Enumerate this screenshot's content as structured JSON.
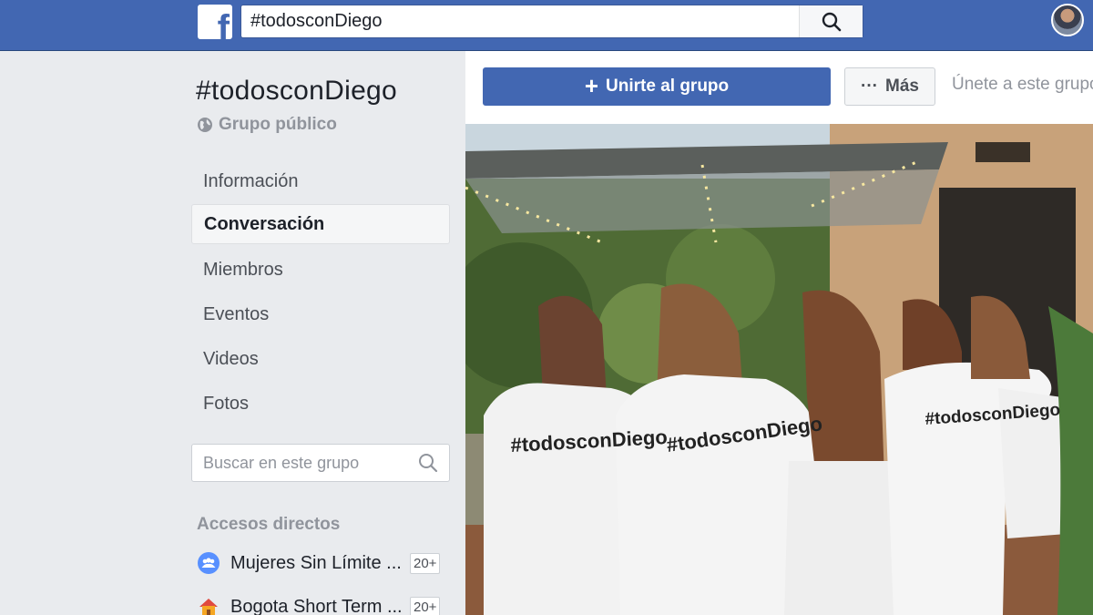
{
  "topbar": {
    "logo": "f",
    "search_value": "#todosconDiego",
    "search_icon": "search-icon"
  },
  "group": {
    "title": "#todosconDiego",
    "type": "Grupo público",
    "type_icon": "globe-icon"
  },
  "nav": {
    "items": [
      {
        "label": "Información"
      },
      {
        "label": "Conversación",
        "active": true
      },
      {
        "label": "Miembros"
      },
      {
        "label": "Eventos"
      },
      {
        "label": "Videos"
      },
      {
        "label": "Fotos"
      }
    ]
  },
  "group_search": {
    "placeholder": "Buscar en este grupo"
  },
  "shortcuts": {
    "title": "Accesos directos",
    "items": [
      {
        "label": "Mujeres Sin Límite ...",
        "badge": "20+",
        "icon": "group-icon"
      },
      {
        "label": "Bogota Short Term ...",
        "badge": "20+",
        "icon": "house-icon"
      }
    ]
  },
  "actions": {
    "join_plus": "+",
    "join_label": "Unirte al grupo",
    "more_dots": "···",
    "more_label": "Más",
    "join_hint": "Únete a este grupo"
  },
  "cover": {
    "shirt_text_1": "#todosconDiego",
    "shirt_text_2": "#todosconDiego",
    "shirt_text_3": "#todosconDiego",
    "colors": {
      "accent": "#4267b2",
      "wall": "#c8a27a",
      "foliage": "#4f6b35",
      "shirt": "#f2f2f2"
    }
  }
}
